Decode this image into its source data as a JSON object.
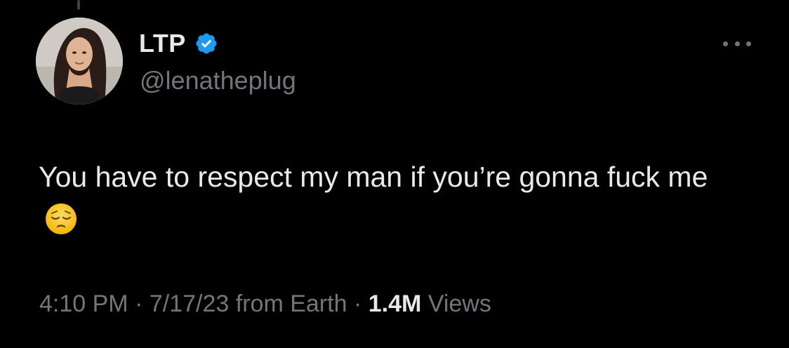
{
  "author": {
    "display_name": "LTP",
    "handle": "@lenatheplug",
    "verified": true,
    "verified_color": "#1d9bf0"
  },
  "tweet": {
    "text": "You have to respect my man if you’re gonna fuck me",
    "emoji": "pensive-face"
  },
  "meta": {
    "time": "4:10 PM",
    "date": "7/17/23",
    "source": "from Earth",
    "separator": "·",
    "views_count": "1.4M",
    "views_label": "Views"
  },
  "colors": {
    "background": "#000000",
    "primary_text": "#e7e9ea",
    "secondary_text": "#71767b"
  },
  "icons": {
    "more": "more-options-icon",
    "verified": "verified-badge-icon"
  }
}
